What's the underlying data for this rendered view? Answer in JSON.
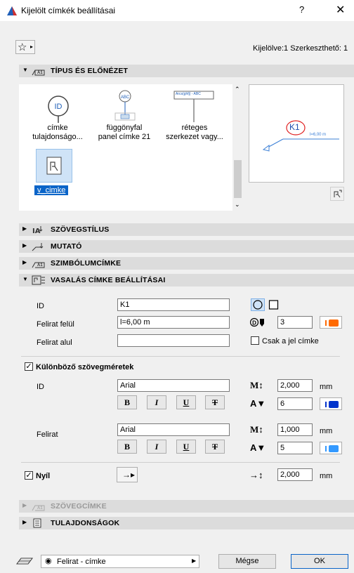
{
  "window": {
    "title": "Kijelölt címkék beállításai",
    "help": "?",
    "close": "✕"
  },
  "toolbar": {
    "favorites_arrow": "▸",
    "selection_info": "Kijelölve:1 Szerkeszthető: 1"
  },
  "sections": {
    "type_preview": "TÍPUS ÉS ELŐNÉZET",
    "text_style": "SZÖVEGSTÍLUS",
    "pointer": "MUTATÓ",
    "symbol_label": "SZIMBÓLUMCÍMKE",
    "rebar_label": "VASALÁS CÍMKE BEÁLLÍTÁSAI",
    "text_label": "SZÖVEGCÍMKE",
    "properties": "TULAJDONSÁGOK"
  },
  "library": {
    "items": [
      {
        "line1": "címke",
        "line2": "tulajdonságo...",
        "icon_text": "ID"
      },
      {
        "line1": "függönyfal",
        "line2": "panel címke 21",
        "icon_text": "ABC"
      },
      {
        "line1": "réteges",
        "line2": "szerkezet vagy...",
        "icon_text": "Arcs(ghfj) - ABC"
      }
    ],
    "selected": "v_cimke"
  },
  "preview": {
    "id_text": "K1",
    "label_text": "l=6,00 m"
  },
  "rebar": {
    "id_label": "ID",
    "id_value": "K1",
    "text_top_label": "Felirat felül",
    "text_top_value": "l=6,00 m",
    "text_bottom_label": "Felirat alul",
    "text_bottom_value": "",
    "pen_value": "3",
    "only_symbol_label": "Csak a jel címke",
    "different_sizes_label": "Különböző szövegméretek",
    "id_group_label": "ID",
    "id_font": "Arial",
    "id_height": "2,000",
    "id_height_unit": "mm",
    "id_pen": "6",
    "felirat_group_label": "Felirat",
    "felirat_font": "Arial",
    "felirat_height": "1,000",
    "felirat_height_unit": "mm",
    "felirat_pen": "5",
    "arrow_label": "Nyíl",
    "arrow_size": "2,000",
    "arrow_unit": "mm",
    "bold": "B",
    "italic": "I",
    "underline": "U",
    "strike": "T",
    "check": "✓"
  },
  "colors": {
    "orange": "#ff6a00",
    "blue": "#0033cc",
    "light_blue": "#3399ff",
    "selected_bg": "#0a64c8",
    "accent_red": "#e02020"
  },
  "footer": {
    "layer_value": "Felirat - címke",
    "cancel": "Mégse",
    "ok": "OK"
  }
}
